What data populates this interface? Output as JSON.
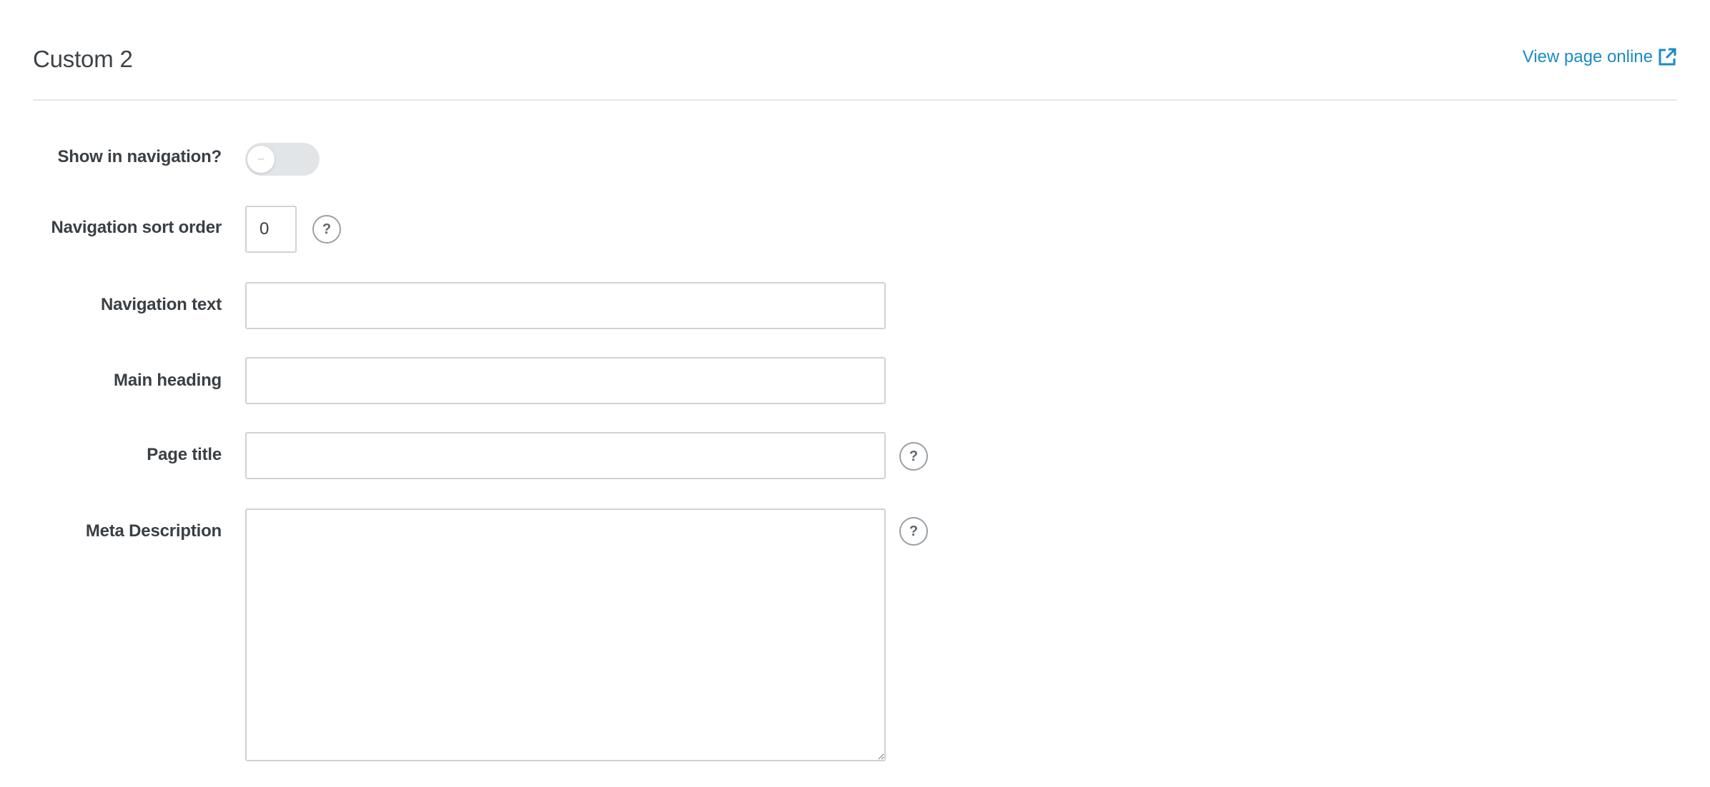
{
  "header": {
    "title": "Custom 2",
    "view_online_label": "View page online",
    "link_icon": "external-link-icon",
    "link_color": "#1a8bc4"
  },
  "form": {
    "show_in_navigation": {
      "label": "Show in navigation?",
      "enabled": false,
      "knob_symbol": "–"
    },
    "navigation_sort_order": {
      "label": "Navigation sort order",
      "value": "0",
      "help_symbol": "?"
    },
    "navigation_text": {
      "label": "Navigation text",
      "value": ""
    },
    "main_heading": {
      "label": "Main heading",
      "value": ""
    },
    "page_title": {
      "label": "Page title",
      "value": "",
      "help_symbol": "?"
    },
    "meta_description": {
      "label": "Meta Description",
      "value": "",
      "help_symbol": "?"
    }
  }
}
